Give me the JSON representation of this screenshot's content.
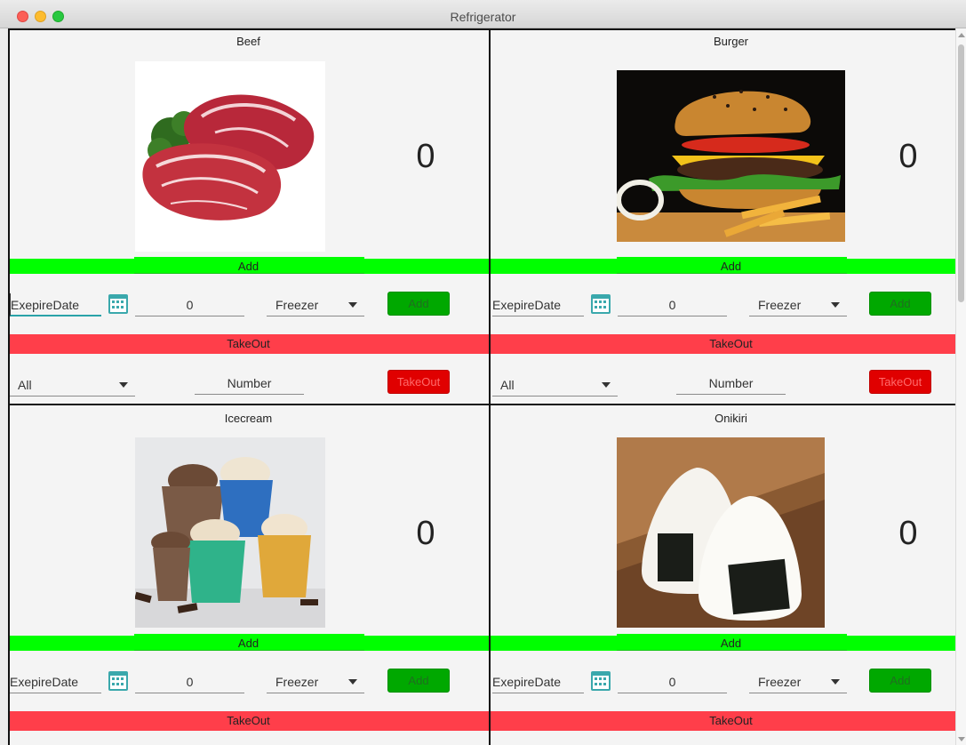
{
  "window": {
    "title": "Refrigerator"
  },
  "panels": [
    {
      "name": "Beef",
      "count": "0",
      "add_bar": "Add",
      "expire_placeholder": "ExepireDate",
      "quantity": "0",
      "location": "Freezer",
      "add_button": "Add",
      "take_bar": "TakeOut",
      "filter": "All",
      "number_placeholder": "Number",
      "take_button": "TakeOut"
    },
    {
      "name": "Burger",
      "count": "0",
      "add_bar": "Add",
      "expire_placeholder": "ExepireDate",
      "quantity": "0",
      "location": "Freezer",
      "add_button": "Add",
      "take_bar": "TakeOut",
      "filter": "All",
      "number_placeholder": "Number",
      "take_button": "TakeOut"
    },
    {
      "name": "Icecream",
      "count": "0",
      "add_bar": "Add",
      "expire_placeholder": "ExepireDate",
      "quantity": "0",
      "location": "Freezer",
      "add_button": "Add",
      "take_bar": "TakeOut"
    },
    {
      "name": "Onikiri",
      "count": "0",
      "add_bar": "Add",
      "expire_placeholder": "ExepireDate",
      "quantity": "0",
      "location": "Freezer",
      "add_button": "Add",
      "take_bar": "TakeOut"
    }
  ],
  "icons": {
    "calendar": "calendar-icon",
    "dropdown": "chevron-down-icon"
  },
  "colors": {
    "add_bar": "#00ff00",
    "add_button": "#00a800",
    "take_bar": "#ff3e4a",
    "take_button": "#e00000",
    "calendar": "#3aa8ac"
  }
}
